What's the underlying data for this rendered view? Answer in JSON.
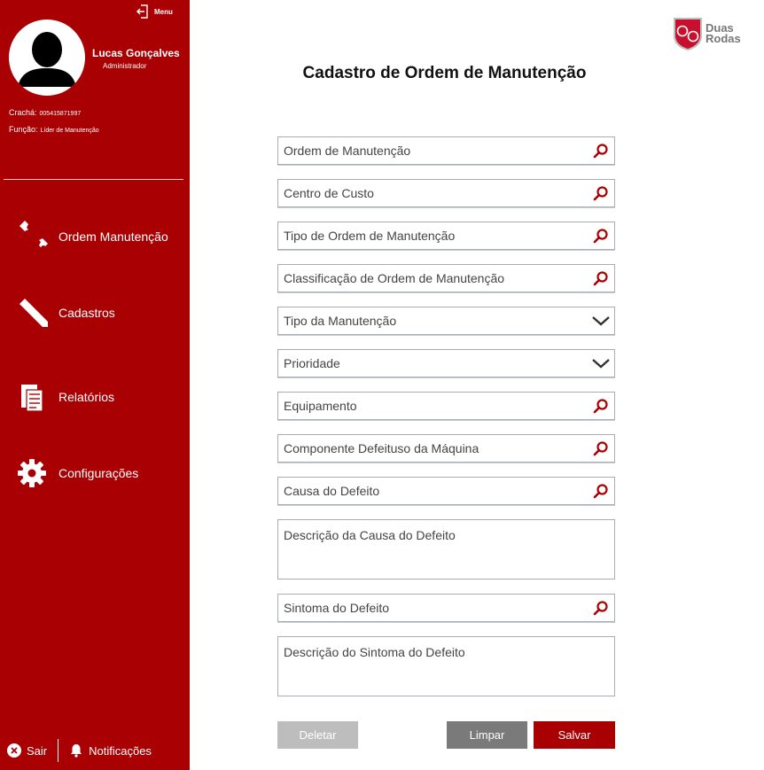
{
  "sidebar": {
    "menu_label": "Menu",
    "user": {
      "name": "Lucas Gonçalves",
      "role": "Administrador"
    },
    "badge_label": "Crachá:",
    "badge_value": "005415871997",
    "function_label": "Função:",
    "function_value": "Líder de Manutenção",
    "nav": [
      {
        "label": "Ordem Manutenção",
        "icon": "wrench-icon"
      },
      {
        "label": "Cadastros",
        "icon": "pencil-icon"
      },
      {
        "label": "Relatórios",
        "icon": "report-icon"
      },
      {
        "label": "Configurações",
        "icon": "gear-icon"
      }
    ],
    "logout_label": "Sair",
    "notifications_label": "Notificações"
  },
  "brand": {
    "line1": "Duas",
    "line2": "Rodas"
  },
  "page": {
    "title": "Cadastro de Ordem de Manutenção"
  },
  "form": {
    "fields": [
      {
        "label": "Ordem de Manutenção",
        "icon": "search-icon"
      },
      {
        "label": "Centro de Custo",
        "icon": "search-icon"
      },
      {
        "label": "Tipo de Ordem de Manutenção",
        "icon": "search-icon"
      },
      {
        "label": "Classificação de Ordem de Manutenção",
        "icon": "search-icon"
      },
      {
        "label": "Tipo da Manutenção",
        "icon": "chevron-down-icon"
      },
      {
        "label": "Prioridade",
        "icon": "chevron-down-icon"
      },
      {
        "label": "Equipamento",
        "icon": "search-icon"
      },
      {
        "label": "Componente Defeituso da Máquina",
        "icon": "search-icon"
      },
      {
        "label": "Causa do Defeito",
        "icon": "search-icon"
      },
      {
        "label": "Descrição da Causa do Defeito"
      },
      {
        "label": "Sintoma do Defeito",
        "icon": "search-icon"
      },
      {
        "label": "Descrição do Sintoma do Defeito"
      }
    ],
    "buttons": {
      "delete": "Deletar",
      "clear": "Limpar",
      "save": "Salvar"
    }
  },
  "colors": {
    "primary": "#a80003",
    "muted_button": "#bdbdbd",
    "clear_button": "#7a7a7a",
    "field_border": "#a7aeb8",
    "accent_icon": "#a80003"
  }
}
